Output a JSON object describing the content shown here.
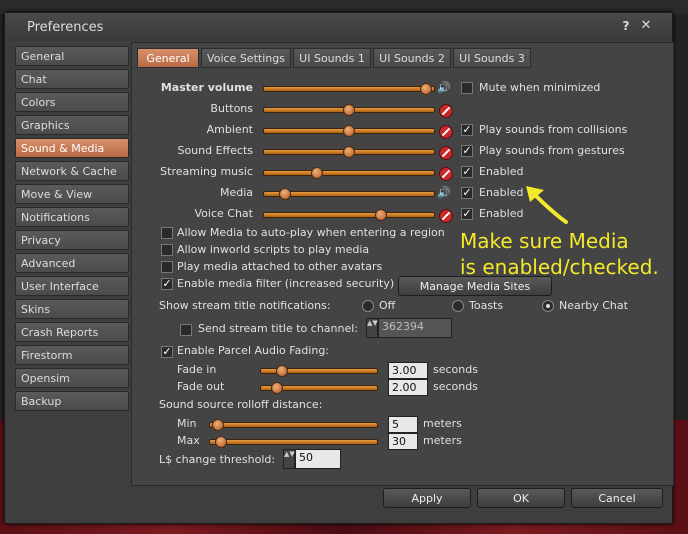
{
  "window": {
    "title": "Preferences",
    "help_icon": "?",
    "close_icon": "✕"
  },
  "sidebar": {
    "items": [
      {
        "label": "General"
      },
      {
        "label": "Chat"
      },
      {
        "label": "Colors"
      },
      {
        "label": "Graphics"
      },
      {
        "label": "Sound & Media",
        "selected": true
      },
      {
        "label": "Network & Cache"
      },
      {
        "label": "Move & View"
      },
      {
        "label": "Notifications"
      },
      {
        "label": "Privacy"
      },
      {
        "label": "Advanced"
      },
      {
        "label": "User Interface"
      },
      {
        "label": "Skins"
      },
      {
        "label": "Crash Reports"
      },
      {
        "label": "Firestorm"
      },
      {
        "label": "Opensim"
      },
      {
        "label": "Backup"
      }
    ]
  },
  "tabs": [
    "General",
    "Voice Settings",
    "UI Sounds 1",
    "UI Sounds 2",
    "UI Sounds 3"
  ],
  "volume": [
    {
      "label": "Master volume",
      "level": 0.98,
      "muted": false,
      "option": "Mute when minimized",
      "option_checked": false
    },
    {
      "label": "Buttons",
      "level": 0.5,
      "muted": true
    },
    {
      "label": "Ambient",
      "level": 0.5,
      "muted": true,
      "option": "Play sounds from collisions",
      "option_checked": true
    },
    {
      "label": "Sound Effects",
      "level": 0.5,
      "muted": true,
      "option": "Play sounds from gestures",
      "option_checked": true
    },
    {
      "label": "Streaming music",
      "level": 0.3,
      "muted": true,
      "option": "Enabled",
      "option_checked": true
    },
    {
      "label": "Media",
      "level": 0.1,
      "muted": false,
      "option": "Enabled",
      "option_checked": true
    },
    {
      "label": "Voice Chat",
      "level": 0.7,
      "muted": true,
      "option": "Enabled",
      "option_checked": true
    }
  ],
  "media_options": [
    {
      "label": "Allow Media to auto-play when entering a region",
      "checked": false
    },
    {
      "label": "Allow inworld scripts to play media",
      "checked": false
    },
    {
      "label": "Play media attached to other avatars",
      "checked": false
    },
    {
      "label": "Enable media filter (increased security)",
      "checked": true
    }
  ],
  "manage_media_sites_label": "Manage Media Sites",
  "stream_notifications": {
    "label": "Show stream title notifications:",
    "options": [
      "Off",
      "Toasts",
      "Nearby Chat"
    ],
    "selected": "Nearby Chat"
  },
  "send_stream": {
    "label": "Send stream title to channel:",
    "checked": false,
    "value": "362394"
  },
  "parcel_fading": {
    "label": "Enable Parcel Audio Fading:",
    "checked": true,
    "fade_in": {
      "label": "Fade in",
      "value": "3.00",
      "unit": "seconds",
      "level": 0.15
    },
    "fade_out": {
      "label": "Fade out",
      "value": "2.00",
      "unit": "seconds",
      "level": 0.1
    }
  },
  "rolloff": {
    "label": "Sound source rolloff distance:",
    "min": {
      "label": "Min",
      "value": "5",
      "unit": "meters",
      "level": 0.02
    },
    "max": {
      "label": "Max",
      "value": "30",
      "unit": "meters",
      "level": 0.04
    }
  },
  "threshold": {
    "label": "L$ change threshold:",
    "value": "50"
  },
  "buttons": {
    "apply": "Apply",
    "ok": "OK",
    "cancel": "Cancel"
  },
  "annotation": {
    "line1": "Make sure Media",
    "line2": "is enabled/checked."
  },
  "colors": {
    "accent": "#c27a52",
    "annotation": "#f4ea2a",
    "slider": "#d98830"
  }
}
